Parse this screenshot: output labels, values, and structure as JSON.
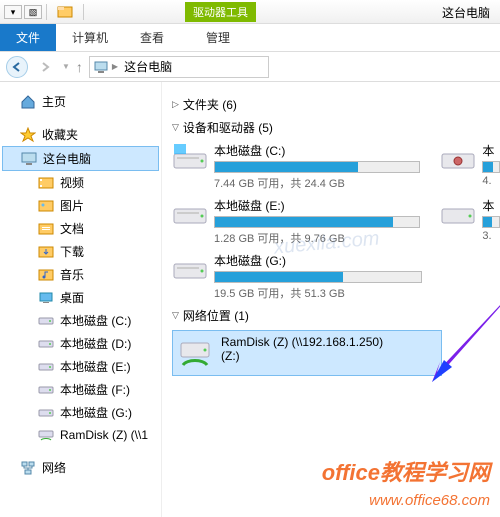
{
  "titlebar": {
    "tool_tab": "驱动器工具",
    "app_title": "这台电脑"
  },
  "ribbon": {
    "file": "文件",
    "computer": "计算机",
    "view": "查看",
    "manage": "管理"
  },
  "address": {
    "location": "这台电脑"
  },
  "sidebar": {
    "home": "主页",
    "favorites": "收藏夹",
    "thispc": "这台电脑",
    "subs": [
      "视频",
      "图片",
      "文档",
      "下载",
      "音乐",
      "桌面"
    ],
    "drives": [
      "本地磁盘 (C:)",
      "本地磁盘 (D:)",
      "本地磁盘 (E:)",
      "本地磁盘 (F:)",
      "本地磁盘 (G:)",
      "RamDisk (Z) (\\\\1"
    ],
    "network": "网络"
  },
  "content": {
    "folders_head": "文件夹 (6)",
    "devices_head": "设备和驱动器 (5)",
    "network_head": "网络位置 (1)",
    "drives": [
      {
        "label": "本地磁盘 (C:)",
        "free": "7.44 GB 可用，共 24.4 GB",
        "pct": 70,
        "has_logo": true
      },
      {
        "label": "本地磁盘 (E:)",
        "free": "1.28 GB 可用，共 9.76 GB",
        "pct": 87
      },
      {
        "label": "本地磁盘 (G:)",
        "free": "19.5 GB 可用，共 51.3 GB",
        "pct": 62
      }
    ],
    "partial": [
      {
        "label": "本",
        "free": "4."
      },
      {
        "label": "本",
        "free": "3."
      }
    ],
    "netloc": {
      "line1": "RamDisk (Z) (\\\\192.168.1.250)",
      "line2": "(Z:)"
    }
  },
  "watermarks": {
    "w1": "office教程学习网",
    "w2": "www.office68.com",
    "w3": "xuexila.com"
  }
}
